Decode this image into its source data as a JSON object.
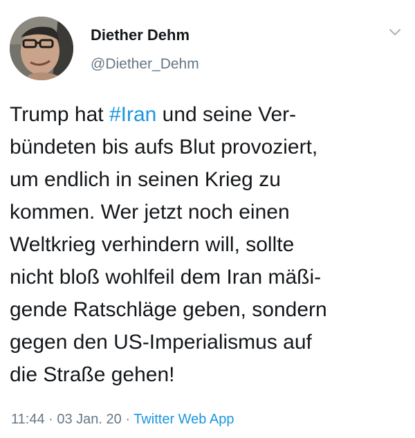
{
  "author": {
    "display_name": "Diether Dehm",
    "handle": "@Diether_Dehm"
  },
  "tweet": {
    "lines": [
      {
        "before": "Trump hat ",
        "hashtag": "#Iran",
        "after": " und seine Ver-"
      },
      {
        "text": "bündeten bis aufs Blut provoziert,"
      },
      {
        "text": "um endlich in seinen Krieg zu"
      },
      {
        "text": "kommen. Wer jetzt noch einen"
      },
      {
        "text": "Weltkrieg verhindern will, sollte"
      },
      {
        "text": "nicht bloß wohlfeil dem Iran mäßi-"
      },
      {
        "text": "gende Ratschläge geben, sondern"
      },
      {
        "text": "gegen den US-Imperialismus auf"
      },
      {
        "text": "die Straße gehen!"
      }
    ]
  },
  "meta": {
    "time": "11:44",
    "separator": " · ",
    "date": "03 Jan. 20",
    "source": "Twitter Web App"
  },
  "icons": {
    "caret": "chevron-down-icon"
  },
  "colors": {
    "link": "#1b95e0",
    "secondary_text": "#657786",
    "text": "#14171a"
  }
}
